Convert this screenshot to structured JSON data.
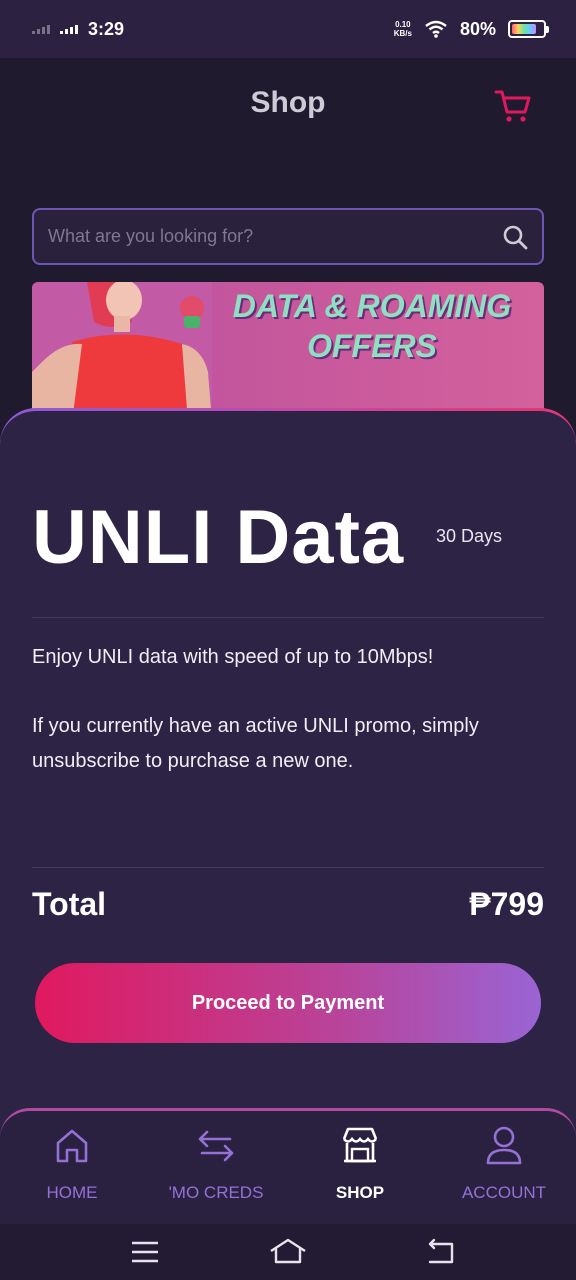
{
  "status_bar": {
    "time": "3:29",
    "net_speed_value": "0.10",
    "net_speed_unit": "KB/s",
    "battery": "80%"
  },
  "header": {
    "title": "Shop"
  },
  "search": {
    "placeholder": "What are you looking for?"
  },
  "banner": {
    "line1": "DATA & ROAMING",
    "line2": "OFFERS"
  },
  "plan": {
    "title": "UNLI Data",
    "validity": "30 Days",
    "description_1": "Enjoy UNLI data with speed of up to 10Mbps!",
    "description_2": "If you currently have an active UNLI promo, simply unsubscribe to purchase a new one.",
    "total_label": "Total",
    "total_value": "₱799",
    "cta": "Proceed to Payment"
  },
  "bottom_nav": {
    "items": [
      {
        "label": "HOME",
        "icon": "home-icon",
        "active": false
      },
      {
        "label": "'MO CREDS",
        "icon": "transfer-icon",
        "active": false
      },
      {
        "label": "SHOP",
        "icon": "store-icon",
        "active": true
      },
      {
        "label": "ACCOUNT",
        "icon": "person-icon",
        "active": false
      }
    ]
  },
  "colors": {
    "accent_pink": "#e0195f",
    "accent_purple": "#9a64d4",
    "sheet_bg": "#2d2344"
  }
}
